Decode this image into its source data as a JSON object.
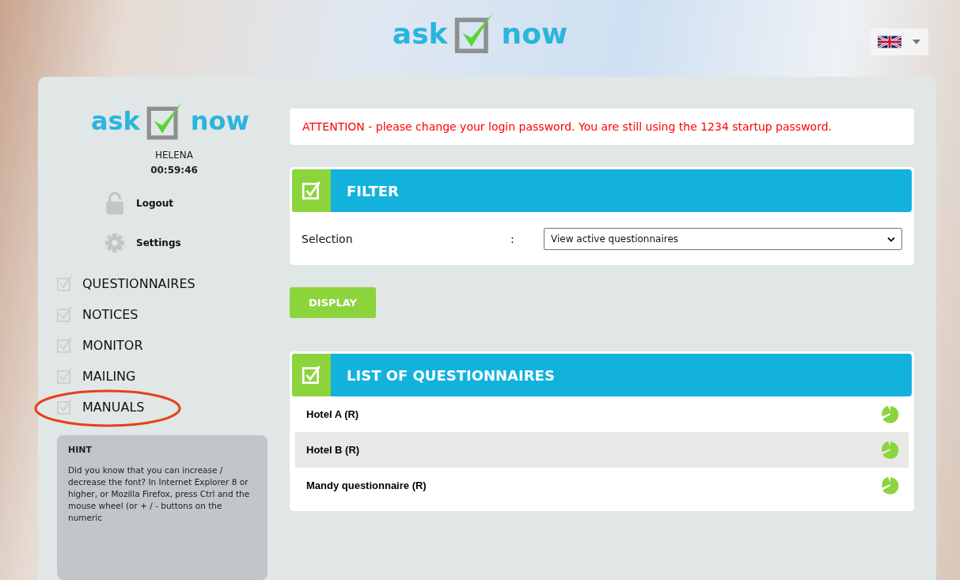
{
  "header": {
    "logo": {
      "left": "ask",
      "right": "now"
    }
  },
  "sidebar": {
    "logo": {
      "left": "ask",
      "right": "now"
    },
    "user": "HELENA",
    "timer": "00:59:46",
    "actions": [
      {
        "kind": "lock",
        "label": "Logout"
      },
      {
        "kind": "gear",
        "label": "Settings"
      }
    ],
    "nav": [
      {
        "label": "QUESTIONNAIRES",
        "circled": false
      },
      {
        "label": "NOTICES",
        "circled": false
      },
      {
        "label": "MONITOR",
        "circled": false
      },
      {
        "label": "MAILING",
        "circled": false
      },
      {
        "label": "MANUALS",
        "circled": true
      }
    ],
    "hint": {
      "title": "HINT",
      "text": "Did you know that you can increase / decrease the font? In Internet Explorer 8 or higher, or Mozilla Firefox, press Ctrl and the mouse wheel (or + / - buttons on the numeric"
    }
  },
  "alert": "ATTENTION - please change your login password. You are still using the 1234 startup password.",
  "filter": {
    "title": "FILTER",
    "label": "Selection",
    "separator": ":",
    "value": "View active questionnaires"
  },
  "display_button": "DISPLAY",
  "list": {
    "title": "LIST OF QUESTIONNAIRES",
    "rows": [
      {
        "name": "Hotel A (R)",
        "selected": false
      },
      {
        "name": "Hotel B (R)",
        "selected": true
      },
      {
        "name": "Mandy questionnaire (R)",
        "selected": false
      }
    ]
  }
}
